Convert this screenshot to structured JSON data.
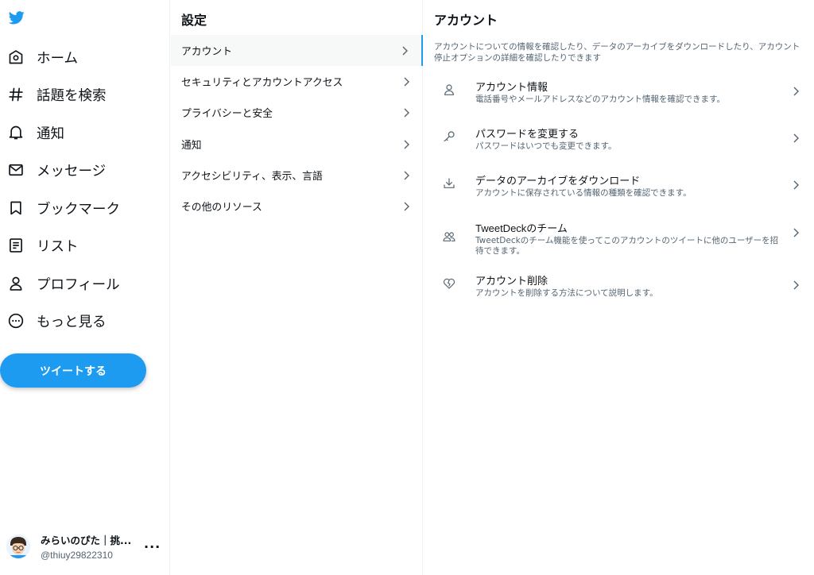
{
  "nav": {
    "items": [
      {
        "label": "ホーム",
        "icon": "home-icon"
      },
      {
        "label": "話題を検索",
        "icon": "hashtag-icon"
      },
      {
        "label": "通知",
        "icon": "bell-icon"
      },
      {
        "label": "メッセージ",
        "icon": "envelope-icon"
      },
      {
        "label": "ブックマーク",
        "icon": "bookmark-icon"
      },
      {
        "label": "リスト",
        "icon": "list-icon"
      },
      {
        "label": "プロフィール",
        "icon": "person-icon"
      },
      {
        "label": "もっと見る",
        "icon": "more-circle-icon"
      }
    ],
    "tweet_button": "ツイートする",
    "account": {
      "name": "みらいのぴた｜挑...",
      "handle": "@thiuy29822310",
      "more": "···"
    }
  },
  "settings": {
    "title": "設定",
    "items": [
      {
        "label": "アカウント",
        "active": true
      },
      {
        "label": "セキュリティとアカウントアクセス"
      },
      {
        "label": "プライバシーと安全"
      },
      {
        "label": "通知"
      },
      {
        "label": "アクセシビリティ、表示、言語"
      },
      {
        "label": "その他のリソース"
      }
    ]
  },
  "account": {
    "title": "アカウント",
    "description": "アカウントについての情報を確認したり、データのアーカイブをダウンロードしたり、アカウント停止オプションの詳細を確認したりできます",
    "items": [
      {
        "title": "アカウント情報",
        "subtitle": "電話番号やメールアドレスなどのアカウント情報を確認できます。",
        "icon": "person-icon"
      },
      {
        "title": "パスワードを変更する",
        "subtitle": "パスワードはいつでも変更できます。",
        "icon": "key-icon"
      },
      {
        "title": "データのアーカイブをダウンロード",
        "subtitle": "アカウントに保存されている情報の種類を確認できます。",
        "icon": "download-icon"
      },
      {
        "title": "TweetDeckのチーム",
        "subtitle": "TweetDeckのチーム機能を使ってこのアカウントのツイートに他のユーザーを招待できます。",
        "icon": "people-icon"
      },
      {
        "title": "アカウント削除",
        "subtitle": "アカウントを削除する方法について説明します。",
        "icon": "broken-heart-icon"
      }
    ]
  },
  "colors": {
    "accent": "#1d9bf0",
    "text": "#0f1419",
    "secondary_text": "#536471",
    "border": "#eff3f4",
    "active_bg": "#f7f9f9"
  }
}
